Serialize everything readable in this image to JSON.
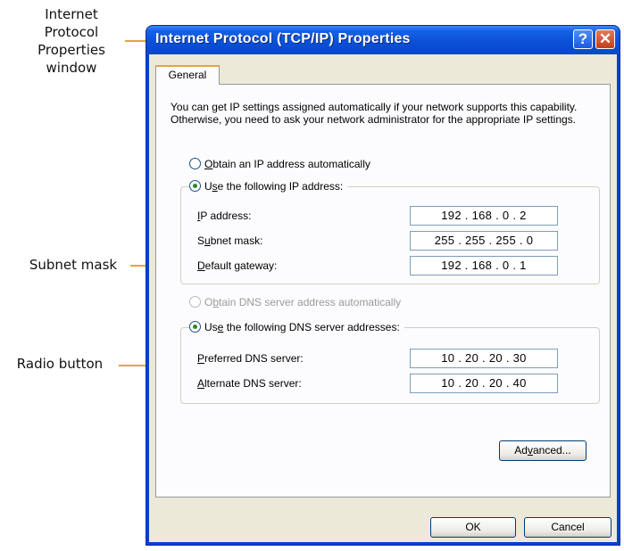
{
  "callouts": {
    "window": "Internet\nProtocol\nProperties\nwindow",
    "subnet": "Subnet mask",
    "radio": "Radio button"
  },
  "window": {
    "title": "Internet Protocol (TCP/IP) Properties",
    "help_glyph": "?",
    "close_glyph": "✕"
  },
  "tab": {
    "label": "General"
  },
  "intro_text": "You can get IP settings assigned automatically if your network supports this capability. Otherwise, you need to ask your network administrator for the appropriate IP settings.",
  "ip_section": {
    "auto_option": {
      "accel": "O",
      "rest": "btain an IP address automatically",
      "selected": false
    },
    "manual_option": {
      "pre": "U",
      "accel": "s",
      "rest": "e the following IP address:",
      "selected": true
    },
    "fields": [
      {
        "pre": "",
        "accel": "I",
        "rest": "P address:",
        "value": "192 . 168 .  0  .  2"
      },
      {
        "pre": "S",
        "accel": "u",
        "rest": "bnet mask:",
        "value": "255 . 255 . 255 .  0"
      },
      {
        "pre": "",
        "accel": "D",
        "rest": "efault gateway:",
        "value": "192 . 168 .  0  .  1"
      }
    ]
  },
  "dns_section": {
    "auto_option": {
      "pre": "O",
      "accel": "b",
      "rest": "tain DNS server address automatically",
      "selected": false,
      "disabled": true
    },
    "manual_option": {
      "pre": "Us",
      "accel": "e",
      "rest": " the following DNS server addresses:",
      "selected": true
    },
    "fields": [
      {
        "pre": "",
        "accel": "P",
        "rest": "referred DNS server:",
        "value": "10  .  20  .  20  .  30"
      },
      {
        "pre": "",
        "accel": "A",
        "rest": "lternate DNS server:",
        "value": "10  .  20  .  20  .  40"
      }
    ]
  },
  "buttons": {
    "advanced": {
      "pre": "Ad",
      "accel": "v",
      "rest": "anced..."
    },
    "ok": "OK",
    "cancel": "Cancel"
  },
  "colors": {
    "callout_line": "#e8a33c",
    "title_bar": "#0b4fd6",
    "dialog_bg": "#ece9d8"
  }
}
